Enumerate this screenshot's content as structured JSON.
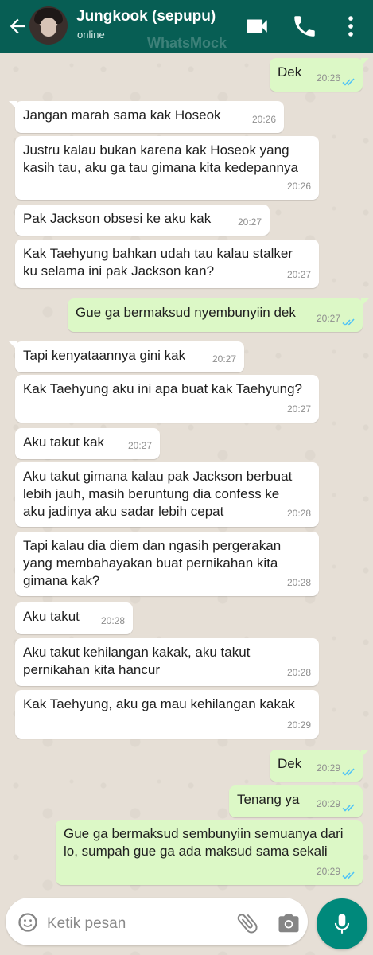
{
  "header": {
    "contact_name": "Jungkook (sepupu)",
    "status": "online",
    "watermark": "WhatsMock"
  },
  "messages": [
    {
      "direction": "out",
      "text": "Dek",
      "time": "20:26",
      "read": true
    },
    {
      "direction": "in",
      "text": "Jangan marah sama kak Hoseok",
      "time": "20:26"
    },
    {
      "direction": "in",
      "text": "Justru kalau bukan karena kak Hoseok yang kasih tau, aku ga tau gimana kita kedepannya",
      "time": "20:26"
    },
    {
      "direction": "in",
      "text": "Pak Jackson obsesi ke aku kak",
      "time": "20:27"
    },
    {
      "direction": "in",
      "text": "Kak Taehyung bahkan udah tau kalau stalker ku selama ini pak Jackson kan?",
      "time": "20:27"
    },
    {
      "direction": "out",
      "text": "Gue ga bermaksud nyembunyiin dek",
      "time": "20:27",
      "read": true
    },
    {
      "direction": "in",
      "text": "Tapi kenyataannya gini kak",
      "time": "20:27"
    },
    {
      "direction": "in",
      "text": "Kak Taehyung aku ini apa buat kak Taehyung?",
      "time": "20:27"
    },
    {
      "direction": "in",
      "text": "Aku takut kak",
      "time": "20:27"
    },
    {
      "direction": "in",
      "text": "Aku takut gimana kalau pak Jackson berbuat lebih jauh, masih beruntung dia confess ke aku jadinya aku sadar lebih cepat",
      "time": "20:28"
    },
    {
      "direction": "in",
      "text": "Tapi kalau dia diem dan ngasih pergerakan yang membahayakan buat pernikahan kita gimana kak?",
      "time": "20:28"
    },
    {
      "direction": "in",
      "text": "Aku takut",
      "time": "20:28"
    },
    {
      "direction": "in",
      "text": "Aku takut kehilangan kakak, aku takut pernikahan kita hancur",
      "time": "20:28"
    },
    {
      "direction": "in",
      "text": "Kak Taehyung, aku ga mau kehilangan kakak",
      "time": "20:29"
    },
    {
      "direction": "out",
      "text": "Dek",
      "time": "20:29",
      "read": true
    },
    {
      "direction": "out",
      "text": "Tenang ya",
      "time": "20:29",
      "read": true
    },
    {
      "direction": "out",
      "text": "Gue ga bermaksud sembunyiin semuanya dari lo, sumpah gue ga ada maksud sama sekali",
      "time": "20:29",
      "read": true
    }
  ],
  "composer": {
    "placeholder": "Ketik pesan"
  },
  "colors": {
    "header": "#075e54",
    "incoming_bubble": "#ffffff",
    "outgoing_bubble": "#dcf8c6",
    "read_tick": "#4fc3f7",
    "mic_button": "#00897b",
    "background": "#e6dfd6"
  },
  "icons": [
    "back-arrow-icon",
    "video-call-icon",
    "phone-icon",
    "more-vert-icon",
    "emoji-icon",
    "attach-icon",
    "camera-icon",
    "mic-icon",
    "double-check-icon"
  ]
}
